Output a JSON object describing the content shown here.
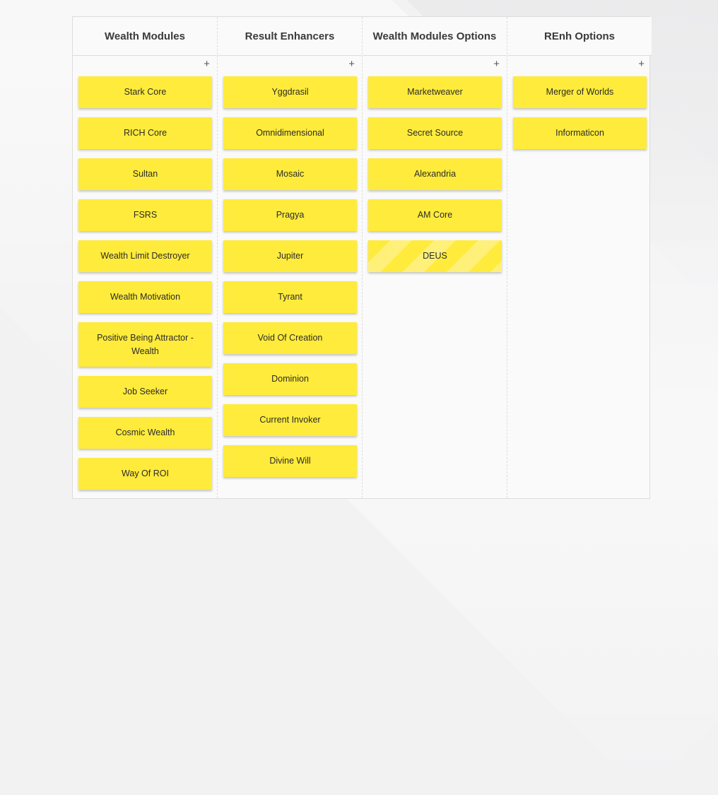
{
  "columns": [
    {
      "title": "Wealth Modules",
      "add_label": "+",
      "cards": [
        "Stark Core",
        "RICH Core",
        "Sultan",
        "FSRS",
        "Wealth Limit Destroyer",
        "Wealth Motivation",
        "Positive Being Attractor - Wealth",
        "Job Seeker",
        "Cosmic Wealth",
        "Way Of ROI"
      ]
    },
    {
      "title": "Result Enhancers",
      "add_label": "+",
      "cards": [
        "Yggdrasil",
        "Omnidimensional",
        "Mosaic",
        "Pragya",
        "Jupiter",
        "Tyrant",
        "Void Of Creation",
        "Dominion",
        "Current Invoker",
        "Divine Will"
      ]
    },
    {
      "title": "Wealth Modules Options",
      "add_label": "+",
      "cards": [
        "Marketweaver",
        "Secret Source",
        "Alexandria",
        "AM Core",
        "DEUS"
      ]
    },
    {
      "title": "REnh Options",
      "add_label": "+",
      "cards": [
        "Merger of Worlds",
        "Informaticon"
      ]
    }
  ],
  "colors": {
    "card": "#ffeb3b",
    "card_stripe": "#fff07a",
    "board_bg": "#fafafa",
    "border": "#dcdcdc"
  },
  "icons": {
    "add": "plus-icon"
  }
}
